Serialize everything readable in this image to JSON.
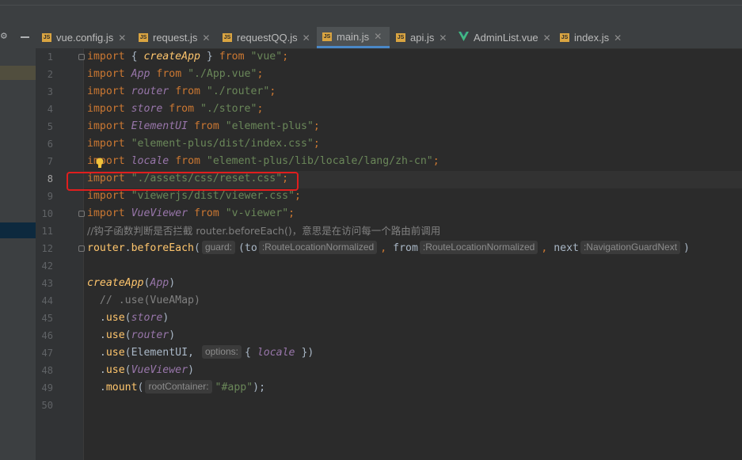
{
  "tabs": [
    {
      "icon": "js-file-icon",
      "label": "vue.config.js",
      "active": false
    },
    {
      "icon": "js-file-icon",
      "label": "request.js",
      "active": false
    },
    {
      "icon": "js-file-icon",
      "label": "requestQQ.js",
      "active": false
    },
    {
      "icon": "js-file-icon",
      "label": "main.js",
      "active": true
    },
    {
      "icon": "js-file-icon",
      "label": "api.js",
      "active": false
    },
    {
      "icon": "vue-file-icon",
      "label": "AdminList.vue",
      "active": false
    },
    {
      "icon": "js-file-icon",
      "label": "index.js",
      "active": false
    }
  ],
  "colors": {
    "active_tab_underline": "#4a88c7",
    "highlight_box": "#e01e1e",
    "keyword": "#cc7832",
    "string": "#6a8759",
    "identifier": "#9876aa",
    "function": "#ffc66d",
    "comment": "#808080"
  },
  "gutter": {
    "line_numbers": [
      "1",
      "2",
      "3",
      "4",
      "5",
      "6",
      "7",
      "8",
      "9",
      "10",
      "11",
      "12",
      "42",
      "43",
      "44",
      "45",
      "46",
      "47",
      "48",
      "49",
      "50"
    ],
    "current_line": "8"
  },
  "code": {
    "l1": {
      "kw": "import",
      "a": " { ",
      "id": "createApp",
      "b": " } ",
      "from": "from",
      "sp": " ",
      "str": "\"vue\"",
      "end": ";"
    },
    "l2": {
      "kw": "import",
      "a": " ",
      "id": "App",
      "b": " ",
      "from": "from",
      "sp": " ",
      "str": "\"./App.vue\"",
      "end": ";"
    },
    "l3": {
      "kw": "import",
      "a": " ",
      "id": "router",
      "b": " ",
      "from": "from",
      "sp": " ",
      "str": "\"./router\"",
      "end": ";"
    },
    "l4": {
      "kw": "import",
      "a": " ",
      "id": "store",
      "b": " ",
      "from": "from",
      "sp": " ",
      "str": "\"./store\"",
      "end": ";"
    },
    "l5": {
      "kw": "import",
      "a": " ",
      "id": "ElementUI",
      "b": " ",
      "from": "from",
      "sp": " ",
      "str": "\"element-plus\"",
      "end": ";"
    },
    "l6": {
      "kw": "import",
      "sp": " ",
      "str": "\"element-plus/dist/index.css\"",
      "end": ";"
    },
    "l7": {
      "kw": "import",
      "a": " ",
      "id": "locale",
      "b": " ",
      "from": "from",
      "sp": " ",
      "str": "\"element-plus/lib/locale/lang/zh-cn\"",
      "end": ";"
    },
    "l8": {
      "kw": "import",
      "sp": " ",
      "str": "\"./assets/css/reset.css\"",
      "end": ";"
    },
    "l9": {
      "kw": "import",
      "sp": " ",
      "str": "\"viewerjs/dist/viewer.css\"",
      "end": ";"
    },
    "l10": {
      "kw": "import",
      "a": " ",
      "id": "VueViewer",
      "b": " ",
      "from": "from",
      "sp": " ",
      "str": "\"v-viewer\"",
      "end": ";"
    },
    "l11": {
      "comment": "//钩子函数判断是否拦截 router.beforeEach()，意思是在访问每一个路由前调用"
    },
    "l12": {
      "obj": "router",
      "dot": ".",
      "fn": "beforeEach",
      "open": "(",
      "hint_guard": "guard:",
      "paren": "(to",
      "hint_to": ":RouteLocationNormalized",
      "comma1": ", ",
      "from_param": "from",
      "hint_from": ":RouteLocationNormalized",
      "comma2": ", ",
      "next_param": "next",
      "hint_next": ":NavigationGuardNext",
      "close": ")"
    },
    "l43": {
      "fn": "createApp",
      "open": "(",
      "id": "App",
      "close": ")"
    },
    "l44": {
      "comment": "  // .use(VueAMap)"
    },
    "l45": {
      "pre": "  .",
      "fn": "use",
      "open": "(",
      "id": "store",
      "close": ")"
    },
    "l46": {
      "pre": "  .",
      "fn": "use",
      "open": "(",
      "id": "router",
      "close": ")"
    },
    "l47": {
      "pre": "  .",
      "fn": "use",
      "open": "(ElementUI, ",
      "hint": "options:",
      "brace_open": "{ ",
      "id": "locale",
      "brace_close": " })"
    },
    "l48": {
      "pre": "  .",
      "fn": "use",
      "open": "(",
      "id": "VueViewer",
      "close": ")"
    },
    "l49": {
      "pre": "  .",
      "fn": "mount",
      "open": "(",
      "hint": "rootContainer:",
      "str": "\"#app\"",
      "end": ");"
    }
  }
}
